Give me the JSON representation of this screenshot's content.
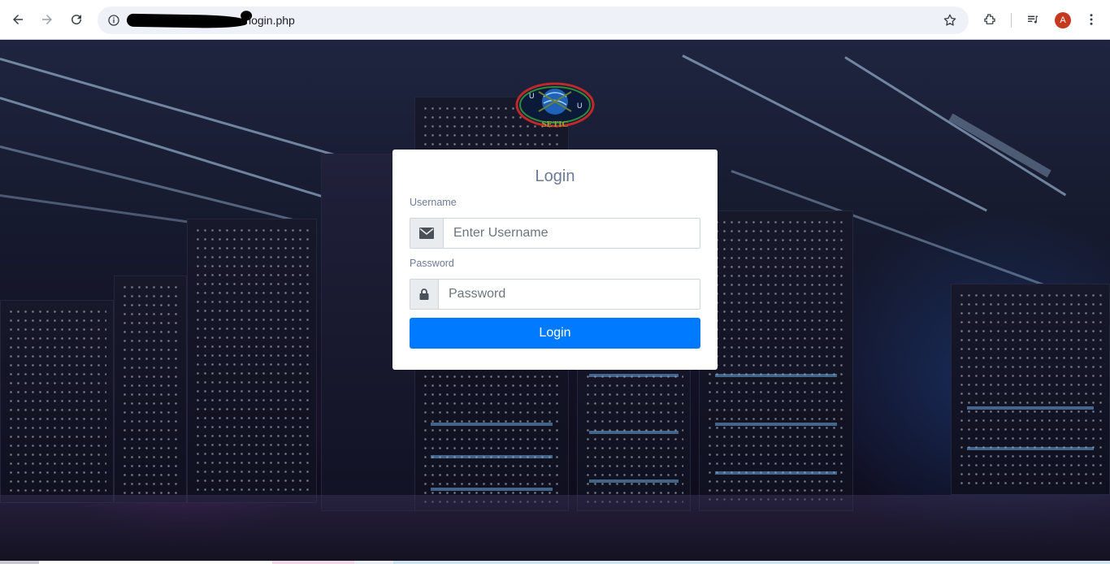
{
  "browser": {
    "url_visible": "login.php",
    "avatar_letter": "A",
    "accent_avatar": "#c5391f"
  },
  "logo": {
    "text": "SETIC",
    "letters": [
      "U",
      "U"
    ]
  },
  "login": {
    "title": "Login",
    "username_label": "Username",
    "username_placeholder": "Enter Username",
    "password_label": "Password",
    "password_placeholder": "Password",
    "button_label": "Login",
    "button_color": "#007bff"
  },
  "icons": {
    "username_addon": "envelope-icon",
    "password_addon": "lock-icon"
  }
}
